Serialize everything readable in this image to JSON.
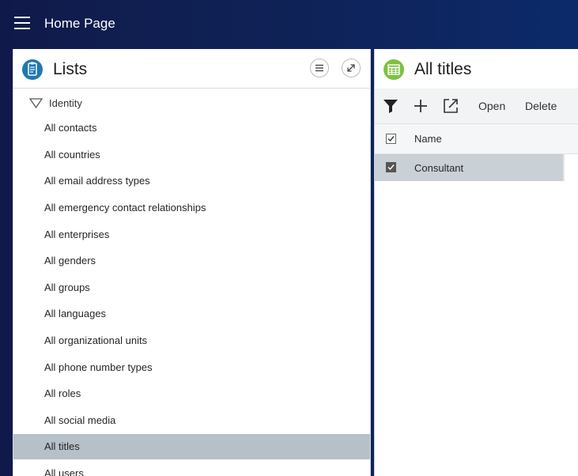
{
  "app": {
    "title": "Home Page"
  },
  "left_panel": {
    "title": "Lists",
    "icon": "list-document-icon",
    "tree_root": "Identity",
    "items": [
      {
        "label": "All contacts"
      },
      {
        "label": "All countries"
      },
      {
        "label": "All email address types"
      },
      {
        "label": "All emergency contact relationships"
      },
      {
        "label": "All enterprises"
      },
      {
        "label": "All genders"
      },
      {
        "label": "All groups"
      },
      {
        "label": "All languages"
      },
      {
        "label": "All organizational units"
      },
      {
        "label": "All phone number types"
      },
      {
        "label": "All roles"
      },
      {
        "label": "All social media"
      },
      {
        "label": "All titles",
        "selected": true
      },
      {
        "label": "All users"
      }
    ]
  },
  "right_panel": {
    "title": "All titles",
    "icon": "table-grid-icon",
    "toolbar": {
      "filter_icon": "filter-icon",
      "add_icon": "plus-icon",
      "export_icon": "open-external-icon",
      "open_label": "Open",
      "delete_label": "Delete"
    },
    "grid": {
      "header_checkbox_checked": true,
      "columns": [
        "Name"
      ],
      "rows": [
        {
          "name": "Consultant",
          "checked": true
        }
      ]
    }
  },
  "colors": {
    "topbar_start": "#101a4a",
    "topbar_end": "#0c2a6a",
    "lists_icon_bg": "#1f78b4",
    "grid_icon_bg": "#7cc242",
    "selected_item_bg": "#b6c0c8",
    "selected_row_bg": "#c9d0d6"
  }
}
